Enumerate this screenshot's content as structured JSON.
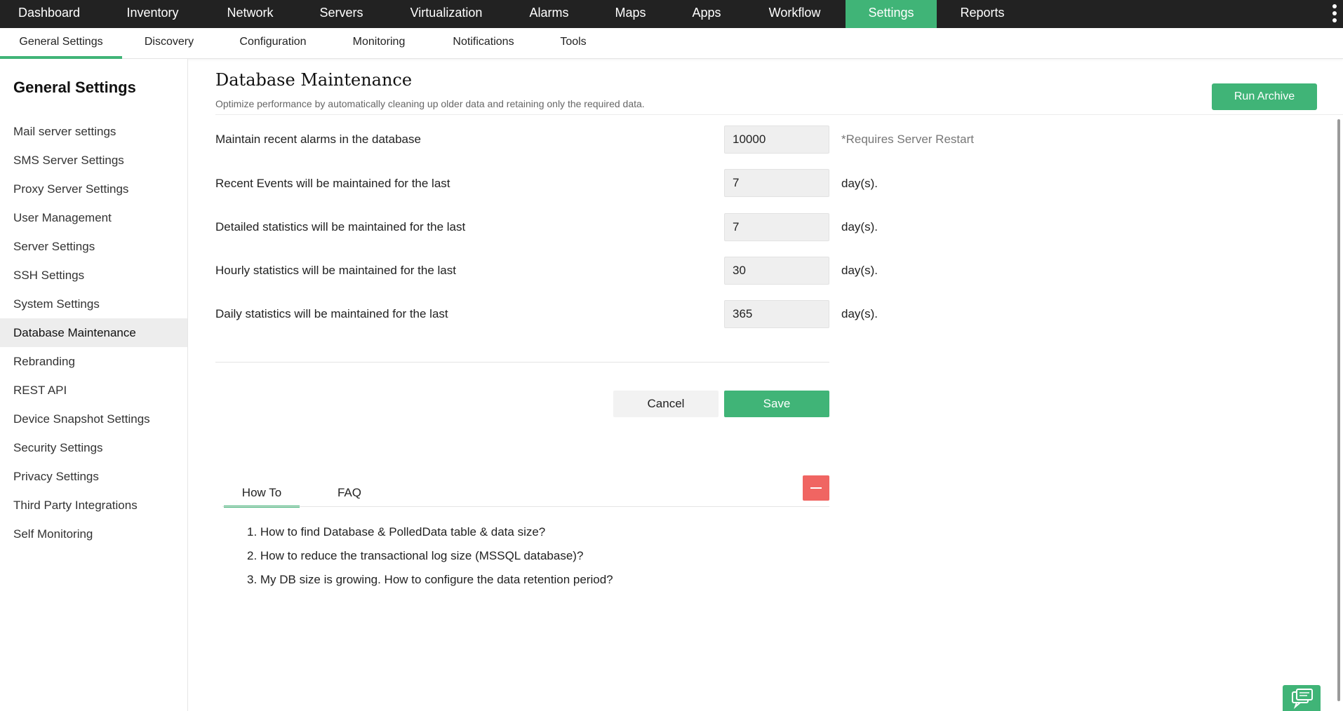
{
  "topnav": {
    "items": [
      "Dashboard",
      "Inventory",
      "Network",
      "Servers",
      "Virtualization",
      "Alarms",
      "Maps",
      "Apps",
      "Workflow",
      "Settings",
      "Reports"
    ],
    "active": "Settings",
    "menu_icon": "vertical-ellipsis-icon"
  },
  "subnav": {
    "items": [
      "General Settings",
      "Discovery",
      "Configuration",
      "Monitoring",
      "Notifications",
      "Tools"
    ],
    "active": "General Settings"
  },
  "sidebar": {
    "title": "General Settings",
    "items": [
      "Mail server settings",
      "SMS Server Settings",
      "Proxy Server Settings",
      "User Management",
      "Server Settings",
      "SSH Settings",
      "System Settings",
      "Database Maintenance",
      "Rebranding",
      "REST API",
      "Device Snapshot Settings",
      "Security Settings",
      "Privacy Settings",
      "Third Party Integrations",
      "Self Monitoring"
    ],
    "active": "Database Maintenance"
  },
  "page": {
    "title": "Database Maintenance",
    "subtitle": "Optimize performance by automatically cleaning up older data and retaining only the required data.",
    "run_archive_label": "Run Archive"
  },
  "form": {
    "rows": [
      {
        "label": "Maintain recent alarms in the database",
        "value": "10000",
        "note": "*Requires Server Restart"
      },
      {
        "label": "Recent Events will be maintained for the last",
        "value": "7",
        "note": "day(s)."
      },
      {
        "label": "Detailed statistics will be maintained for the last",
        "value": "7",
        "note": "day(s)."
      },
      {
        "label": "Hourly statistics will be maintained for the last",
        "value": "30",
        "note": "day(s)."
      },
      {
        "label": "Daily statistics will be maintained for the last",
        "value": "365",
        "note": "day(s)."
      }
    ],
    "cancel_label": "Cancel",
    "save_label": "Save"
  },
  "help": {
    "tabs": [
      "How To",
      "FAQ"
    ],
    "active_tab": "How To",
    "collapse_icon": "minus-icon",
    "items": [
      "1. How to find Database & PolledData table & data size?",
      "2. How to reduce the transactional log size (MSSQL database)?",
      "3. My DB size is growing. How to configure the data retention period?"
    ]
  },
  "chat_icon": "chat-icon",
  "colors": {
    "accent": "#40b477",
    "topbar": "#222222",
    "danger": "#f06562"
  }
}
